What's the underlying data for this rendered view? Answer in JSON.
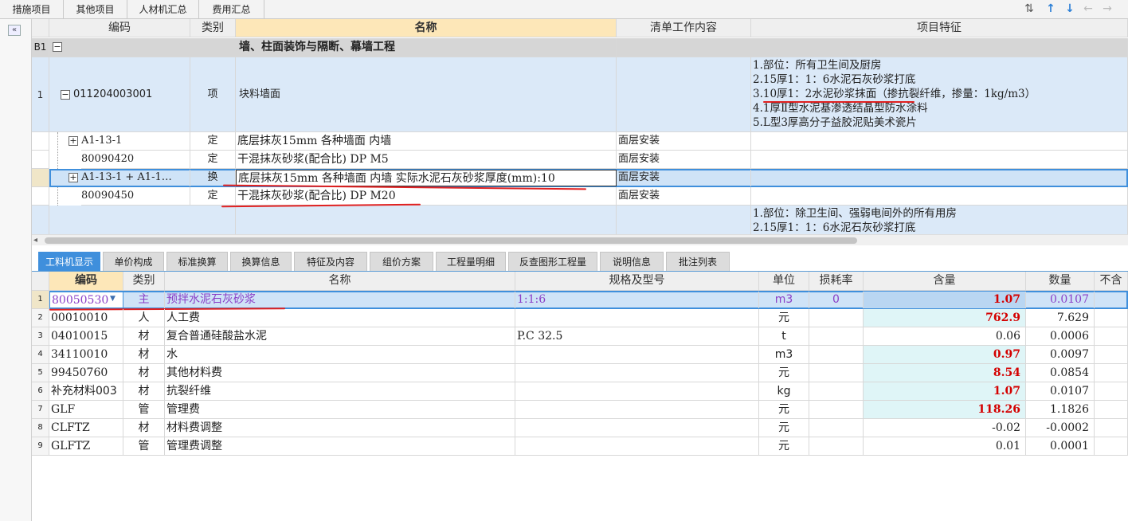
{
  "top_tabs": [
    "措施项目",
    "其他项目",
    "人材机汇总",
    "费用汇总"
  ],
  "upper_headers": {
    "code": "编码",
    "type": "类别",
    "name": "名称",
    "work": "清单工作内容",
    "feature": "项目特征"
  },
  "section": {
    "num": "B1",
    "name": "墙、柱面装饰与隔断、幕墙工程"
  },
  "item1": {
    "num": "1",
    "code": "011204003001",
    "type": "项",
    "name": "块料墙面",
    "features": [
      "1.部位：所有卫生间及厨房",
      "2.15厚1：1：6水泥石灰砂浆打底",
      "3.10厚1：2水泥砂浆抹面（掺抗裂纤维，掺量：1kg/m3）",
      "4.1厚Ⅱ型水泥基渗透结晶型防水涂料",
      "5.L型3厚高分子益胶泥贴美术瓷片"
    ]
  },
  "sub_rows": [
    {
      "code": "A1-13-1",
      "expand": "+",
      "type": "定",
      "name": "底层抹灰15mm 各种墙面 内墙",
      "work": "面层安装"
    },
    {
      "code": "80090420",
      "expand": "",
      "type": "定",
      "name": "干混抹灰砂浆(配合比) DP M5",
      "work": "面层安装"
    },
    {
      "code": "A1-13-1 + A1-1…",
      "expand": "+",
      "type": "换",
      "name": "底层抹灰15mm 各种墙面 内墙  实际水泥石灰砂浆厚度(mm):10",
      "work": "面层安装"
    },
    {
      "code": "80090450",
      "expand": "",
      "type": "定",
      "name": "干混抹灰砂浆(配合比) DP M20",
      "work": "面层安装"
    }
  ],
  "item2_features": [
    "1.部位：除卫生间、强弱电间外的所有用房",
    "2.15厚1：1：6水泥石灰砂浆打底"
  ],
  "lower_tabs": [
    "工料机显示",
    "单价构成",
    "标准换算",
    "换算信息",
    "特征及内容",
    "组价方案",
    "工程量明细",
    "反查图形工程量",
    "说明信息",
    "批注列表"
  ],
  "lower_headers": {
    "code": "编码",
    "type": "类别",
    "name": "名称",
    "spec": "规格及型号",
    "unit": "单位",
    "loss": "损耗率",
    "content": "含量",
    "qty": "数量",
    "extra": "不含"
  },
  "lower_rows": [
    {
      "n": "1",
      "code": "80050530",
      "type": "主",
      "name": "预拌水泥石灰砂浆",
      "spec": "1:1:6",
      "unit": "m3",
      "loss": "0",
      "content": "1.07",
      "qty": "0.0107"
    },
    {
      "n": "2",
      "code": "00010010",
      "type": "人",
      "name": "人工费",
      "spec": "",
      "unit": "元",
      "loss": "",
      "content": "762.9",
      "qty": "7.629"
    },
    {
      "n": "3",
      "code": "04010015",
      "type": "材",
      "name": "复合普通硅酸盐水泥",
      "spec": "P.C 32.5",
      "unit": "t",
      "loss": "",
      "content": "0.06",
      "qty": "0.0006"
    },
    {
      "n": "4",
      "code": "34110010",
      "type": "材",
      "name": "水",
      "spec": "",
      "unit": "m3",
      "loss": "",
      "content": "0.97",
      "qty": "0.0097"
    },
    {
      "n": "5",
      "code": "99450760",
      "type": "材",
      "name": "其他材料费",
      "spec": "",
      "unit": "元",
      "loss": "",
      "content": "8.54",
      "qty": "0.0854"
    },
    {
      "n": "6",
      "code": "补充材料003",
      "type": "材",
      "name": "抗裂纤维",
      "spec": "",
      "unit": "kg",
      "loss": "",
      "content": "1.07",
      "qty": "0.0107"
    },
    {
      "n": "7",
      "code": "GLF",
      "type": "管",
      "name": "管理费",
      "spec": "",
      "unit": "元",
      "loss": "",
      "content": "118.26",
      "qty": "1.1826"
    },
    {
      "n": "8",
      "code": "CLFTZ",
      "type": "材",
      "name": "材料费调整",
      "spec": "",
      "unit": "元",
      "loss": "",
      "content": "-0.02",
      "qty": "-0.0002"
    },
    {
      "n": "9",
      "code": "GLFTZ",
      "type": "管",
      "name": "管理费调整",
      "spec": "",
      "unit": "元",
      "loss": "",
      "content": "0.01",
      "qty": "0.0001"
    }
  ],
  "icons": {
    "collapse": "«",
    "tree_minus": "−",
    "tree_plus": "+",
    "dropdown": "▼",
    "arrows": [
      "⇅",
      "↑",
      "↓",
      "←",
      "→"
    ]
  },
  "colors": {
    "accent": "#3f8fdc",
    "selected_row": "#cfe3f7",
    "highlight": "#d40000"
  }
}
